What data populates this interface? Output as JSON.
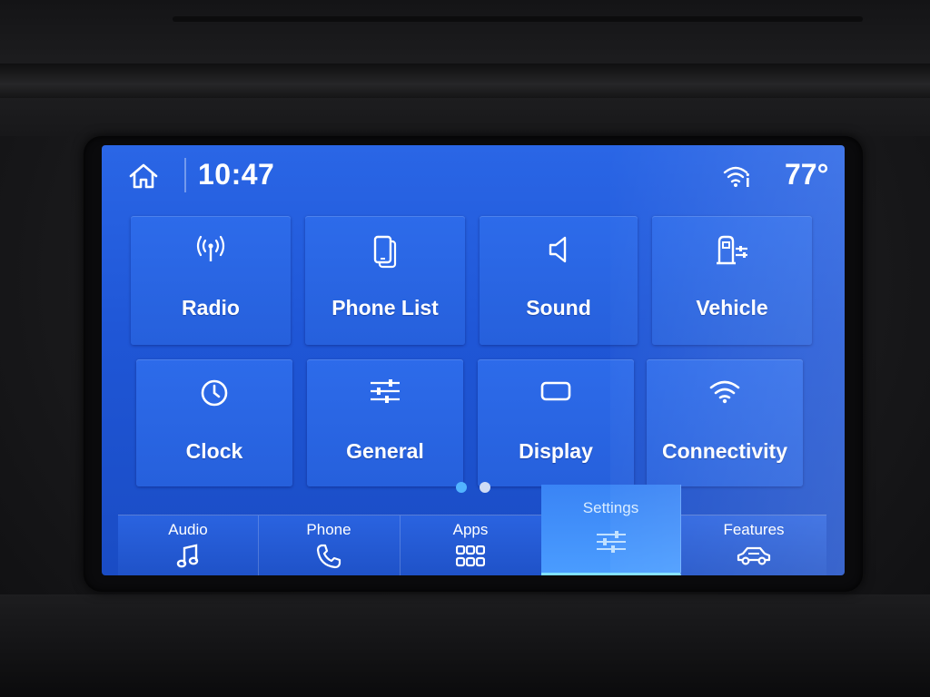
{
  "status": {
    "time": "10:47",
    "temperature": "77°",
    "icons": {
      "home": "home-icon",
      "wifi": "wifi-hotspot-icon"
    }
  },
  "tiles": [
    {
      "label": "Radio",
      "icon": "radio-antenna-icon"
    },
    {
      "label": "Phone List",
      "icon": "phone-list-icon"
    },
    {
      "label": "Sound",
      "icon": "speaker-icon"
    },
    {
      "label": "Vehicle",
      "icon": "vehicle-settings-icon"
    },
    {
      "label": "Clock",
      "icon": "clock-icon"
    },
    {
      "label": "General",
      "icon": "sliders-icon"
    },
    {
      "label": "Display",
      "icon": "display-icon"
    },
    {
      "label": "Connectivity",
      "icon": "wifi-icon"
    }
  ],
  "pager": {
    "pages": 2,
    "current": 1
  },
  "nav": [
    {
      "label": "Audio",
      "icon": "music-note-icon",
      "active": false
    },
    {
      "label": "Phone",
      "icon": "phone-icon",
      "active": false
    },
    {
      "label": "Apps",
      "icon": "apps-grid-icon",
      "active": false
    },
    {
      "label": "Settings",
      "icon": "settings-sliders-icon",
      "active": true
    },
    {
      "label": "Features",
      "icon": "car-features-icon",
      "active": false
    }
  ],
  "colors": {
    "screen": "#2266e0",
    "active_tab": "#4a9cff",
    "active_dot": "#52b4ff",
    "text": "#ffffff"
  }
}
